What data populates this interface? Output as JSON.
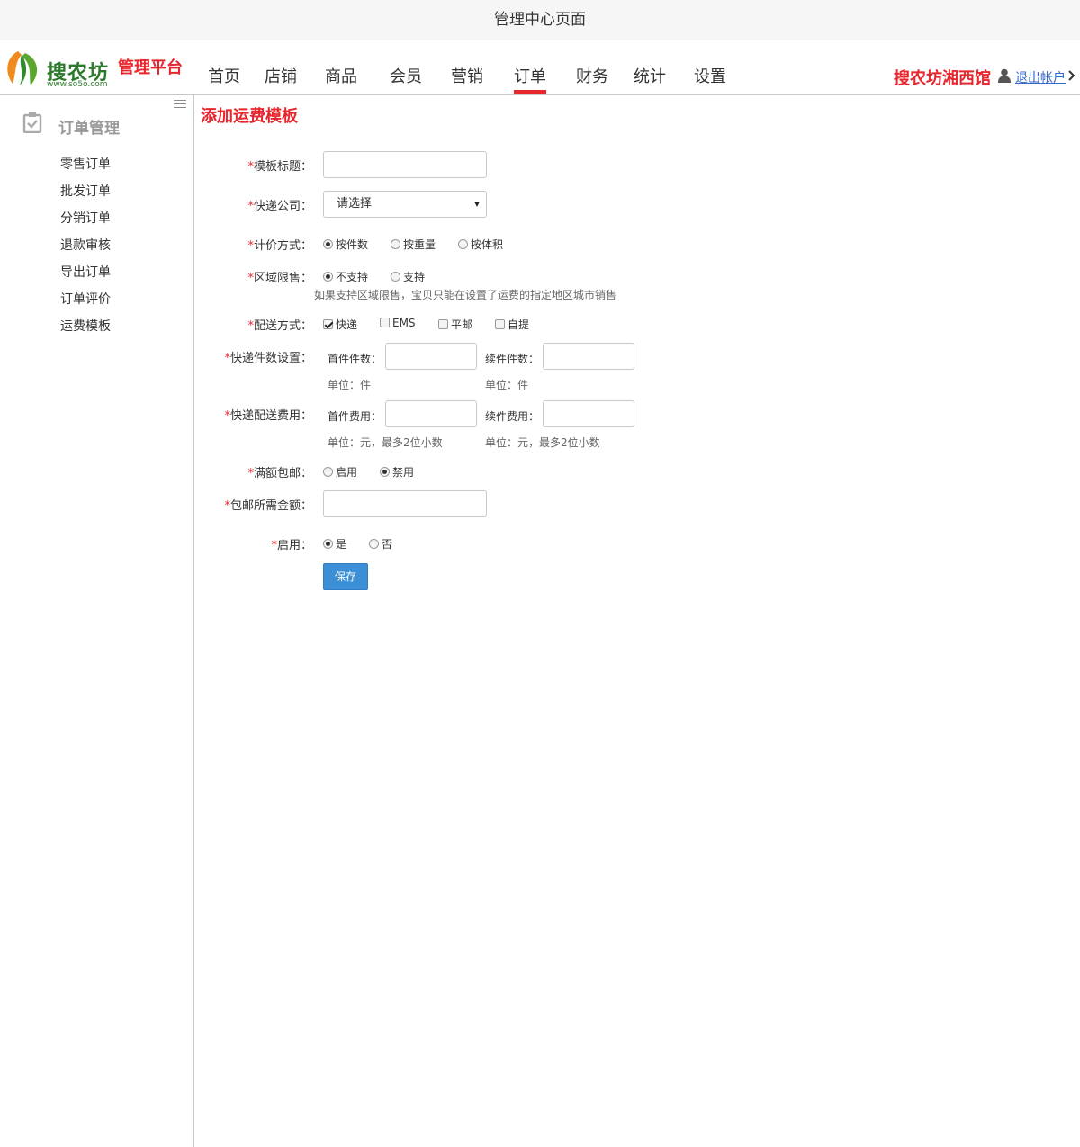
{
  "window": {
    "title": "管理中心页面"
  },
  "header": {
    "brand": "搜农坊",
    "brand_url": "www.so5o.com",
    "platform": "管理平台",
    "nav": [
      "首页",
      "店铺",
      "商品",
      "会员",
      "营销",
      "订单",
      "财务",
      "统计",
      "设置"
    ],
    "active_nav": "订单",
    "shop_name": "搜农坊湘西馆",
    "logout": "退出帐户"
  },
  "sidebar": {
    "heading": "订单管理",
    "items": [
      "零售订单",
      "批发订单",
      "分销订单",
      "退款审核",
      "导出订单",
      "订单评价",
      "运费模板"
    ]
  },
  "form": {
    "page_title": "添加运费模板",
    "required_mark": "*",
    "template_title": {
      "label": "模板标题：",
      "value": ""
    },
    "express_company": {
      "label": "快递公司：",
      "selected": "请选择"
    },
    "pricing": {
      "label": "计价方式：",
      "options": [
        "按件数",
        "按重量",
        "按体积"
      ],
      "selected": "按件数"
    },
    "region_limit": {
      "label": "区域限售：",
      "options": [
        "不支持",
        "支持"
      ],
      "selected": "不支持",
      "hint": "如果支持区域限售，宝贝只能在设置了运费的指定地区城市销售"
    },
    "delivery": {
      "label": "配送方式：",
      "options": [
        "快递",
        "EMS",
        "平邮",
        "自提"
      ],
      "checked": [
        "快递"
      ]
    },
    "express_count": {
      "label": "快递件数设置：",
      "first_label": "首件件数：",
      "next_label": "续件件数：",
      "first_value": "",
      "next_value": "",
      "unit_hint": "单位：件"
    },
    "express_fee": {
      "label": "快递配送费用：",
      "first_label": "首件费用：",
      "next_label": "续件费用：",
      "first_value": "",
      "next_value": "",
      "unit_hint": "单位：元，最多2位小数"
    },
    "free_shipping": {
      "label": "满额包邮：",
      "options": [
        "启用",
        "禁用"
      ],
      "selected": "禁用"
    },
    "free_shipping_amount": {
      "label": "包邮所需金额：",
      "value": ""
    },
    "enabled": {
      "label": "启用：",
      "options": [
        "是",
        "否"
      ],
      "selected": "是"
    },
    "save_label": "保存"
  },
  "colors": {
    "accent": "#e8262d",
    "brand_green": "#2b7a2b",
    "button": "#3b8fd6",
    "link": "#3366cc"
  }
}
